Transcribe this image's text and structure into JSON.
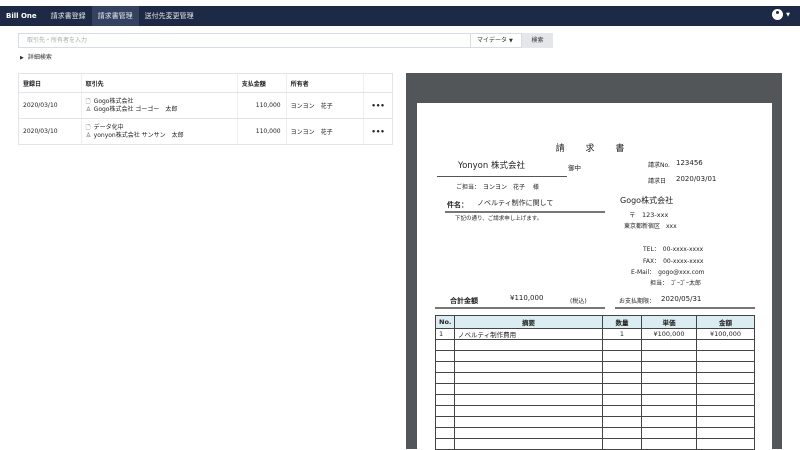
{
  "app": {
    "brand": "Bill One",
    "nav": [
      "請求書登録",
      "請求書管理",
      "送付先変更管理"
    ]
  },
  "search": {
    "placeholder": "取引先・所有者を入力",
    "scope": "マイデータ",
    "button": "検索",
    "advanced": "詳細検索"
  },
  "table": {
    "headers": [
      "登録日",
      "取引先",
      "支払金額",
      "所有者"
    ],
    "rows": [
      {
        "date": "2020/03/10",
        "partner1": "Gogo株式会社",
        "partner2": "Gogo株式会社 ゴーゴー　太郎",
        "amount": "110,000",
        "owner": "ヨンヨン　花子",
        "more": "•••"
      },
      {
        "date": "2020/03/10",
        "partner1": "データ化中",
        "partner2": "yonyon株式会社 サンサン　太郎",
        "amount": "110,000",
        "owner": "ヨンヨン　花子",
        "more": "•••"
      }
    ]
  },
  "invoice": {
    "title": "請 求 書",
    "to": "Yonyon 株式会社",
    "onchu": "御中",
    "tanto": "ご担当：　ヨンヨン　花子　 様",
    "subject_label": "件名：",
    "subject": "ノベルティ制作に関して",
    "note": "下記の通り、ご請求申し上げます。",
    "invoice_no_label": "請求No.",
    "invoice_no": "123456",
    "date_label": "請求日",
    "date": "2020/03/01",
    "seller": "Gogo株式会社",
    "zip": "〒　123-xxx",
    "address": "東京都新宿区　xxx",
    "tel": "TEL：　00-xxxx-xxxx",
    "fax": "FAX：　00-xxxx-xxxx",
    "email": "E-Mail：　gogo@xxx.com",
    "staff": "担当：　ｺﾞｰｺﾞｰ太郎",
    "total_label": "合計金額",
    "total": "¥110,000",
    "tax_note": "(税込)",
    "due_label": "お支払期限：",
    "due": "2020/05/31",
    "item_headers": [
      "No.",
      "摘要",
      "数量",
      "単価",
      "金額"
    ],
    "item": {
      "no": "1",
      "desc": "ノベルティ制作費用",
      "qty": "1",
      "unit": "¥100,000",
      "amount": "¥100,000"
    }
  },
  "colors": {
    "topbar": "#1e2a45",
    "viewer_bg": "#525659",
    "item_header": "#dcecf3"
  }
}
